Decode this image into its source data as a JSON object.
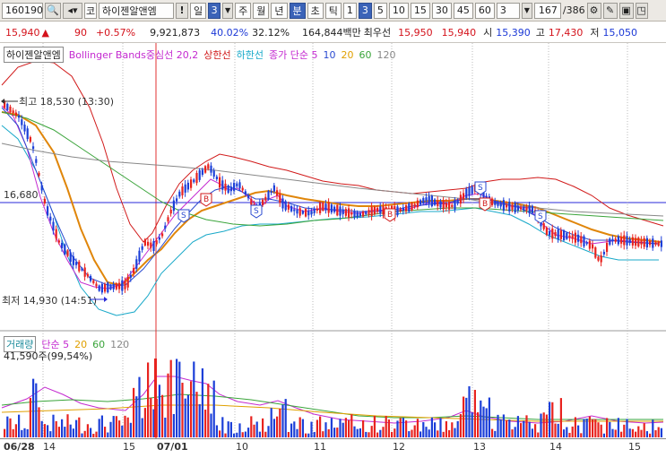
{
  "toolbar": {
    "code": "160190",
    "market_label": "코",
    "stock_name": "하이젠알앤엠",
    "warn_label": "!",
    "day_label": "일",
    "period_value": "3",
    "week": "주",
    "month": "월",
    "year": "년",
    "minute": "분",
    "second": "초",
    "tick": "틱",
    "intervals": [
      "1",
      "3",
      "5",
      "10",
      "15",
      "30",
      "45",
      "60"
    ],
    "selected_interval": "3",
    "count_value": "3",
    "page_current": "167",
    "page_total": "/386"
  },
  "quote": {
    "price": "15,940",
    "change": "90",
    "change_pct": "+0.57%",
    "volume": "9,921,873",
    "turnover_pct": "40.02%",
    "vol_ratio": "32.12%",
    "amount": "164,844백만",
    "best_label": "최우선",
    "ask": "15,950",
    "bid": "15,940",
    "open_label": "시",
    "open": "15,390",
    "high_label": "고",
    "high": "17,430",
    "low_label": "저",
    "low": "15,050"
  },
  "legend": {
    "name": "하이젠알앤엠",
    "bb": "Bollinger Bands중심선 20,2",
    "upper": "상한선",
    "lower": "하한선",
    "ma": "종가 단순 5",
    "ma10": "10",
    "ma20": "20",
    "ma60": "60",
    "ma120": "120"
  },
  "volume_legend": {
    "name": "거래량",
    "ma": "단순 5",
    "ma20": "20",
    "ma60": "60",
    "ma120": "120",
    "value": "41,590주(99,54%)"
  },
  "annotations": {
    "high": "최고 18,530 (13:30)",
    "low": "최저 14,930 (14:51)",
    "hline": "16,680"
  },
  "xaxis": [
    "06/28",
    "14",
    "15",
    "07/01",
    "10",
    "11",
    "12",
    "13",
    "14",
    "15"
  ],
  "colors": {
    "up": "#e8231f",
    "down": "#1c3fd8",
    "upper_band": "#d11a1a",
    "lower_band": "#19a9c9",
    "mid_band": "#e0860a",
    "ma5": "#c42ad0",
    "ma10": "#2a4ad0",
    "ma20": "#3aa43a",
    "ma60": "#888888"
  }
}
